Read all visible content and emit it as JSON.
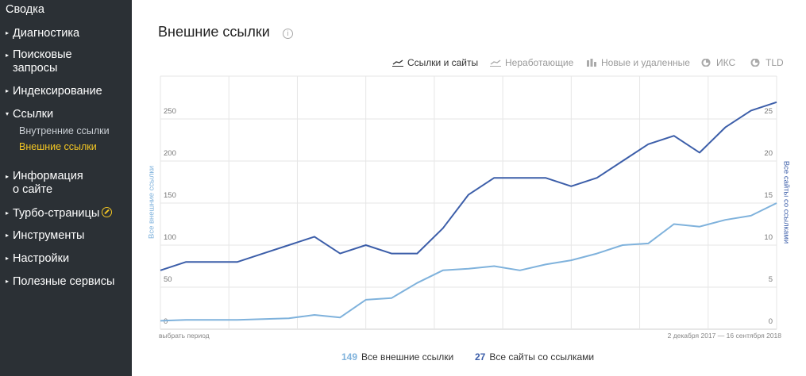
{
  "sidebar": {
    "items": [
      {
        "label": "Сводка"
      },
      {
        "label": "Диагностика"
      },
      {
        "label_lines": [
          "Поисковые",
          "запросы"
        ]
      },
      {
        "label": "Индексирование"
      },
      {
        "label": "Ссылки",
        "expanded": true,
        "children": [
          {
            "label": "Внутренние ссылки"
          },
          {
            "label": "Внешние ссылки",
            "active": true
          }
        ]
      },
      {
        "label_lines": [
          "Информация",
          "о сайте"
        ]
      },
      {
        "label": "Турбо-страницы"
      },
      {
        "label": "Инструменты"
      },
      {
        "label": "Настройки"
      },
      {
        "label": "Полезные сервисы"
      }
    ],
    "colors": {
      "background": "#2b3035",
      "active": "#f3c623"
    }
  },
  "page": {
    "title": "Внешние ссылки",
    "info_icon": "info-icon"
  },
  "tabs": [
    {
      "label": "Ссылки и сайты",
      "icon": "line-chart-icon",
      "active": true
    },
    {
      "label": "Неработающие",
      "icon": "line-chart-icon"
    },
    {
      "label": "Новые и удаленные",
      "icon": "bar-chart-icon"
    },
    {
      "label": "ИКС",
      "icon": "pie-chart-icon"
    },
    {
      "label": "TLD",
      "icon": "pie-chart-icon"
    }
  ],
  "chart": {
    "period_link": "выбрать период",
    "date_range": "2 декабря 2017 — 16 сентября 2018",
    "left_axis_title": "Все внешние ссылки",
    "right_axis_title": "Все сайты со ссылками"
  },
  "chart_data": {
    "type": "line",
    "ylabel_left": "Все внешние ссылки",
    "ylabel_right": "Все сайты со ссылками",
    "left_ticks": [
      "0",
      "50",
      "100",
      "150",
      "200",
      "250"
    ],
    "right_ticks": [
      "0",
      "5",
      "10",
      "15",
      "20",
      "25"
    ],
    "ylim_left": [
      0,
      250
    ],
    "ylim_right": [
      0,
      25
    ],
    "grid": true,
    "series": [
      {
        "name": "Все внешние ссылки",
        "axis": "left",
        "color": "#7fb2dc",
        "values": [
          10,
          11,
          11,
          11,
          12,
          13,
          17,
          14,
          35,
          37,
          55,
          70,
          72,
          75,
          70,
          77,
          82,
          90,
          100,
          102,
          125,
          122,
          130,
          135,
          150
        ]
      },
      {
        "name": "Все сайты со ссылками",
        "axis": "right",
        "color": "#3c5ea9",
        "values": [
          7,
          8,
          8,
          8,
          9,
          10,
          11,
          9,
          10,
          9,
          9,
          12,
          16,
          18,
          18,
          18,
          17,
          18,
          20,
          22,
          23,
          21,
          24,
          26,
          27
        ]
      }
    ],
    "legend_placement": "bottom"
  },
  "legend": [
    {
      "value": "149",
      "label": "Все внешние ссылки",
      "color": "#7fb2dc"
    },
    {
      "value": "27",
      "label": "Все сайты со ссылками",
      "color": "#3c5ea9"
    }
  ]
}
